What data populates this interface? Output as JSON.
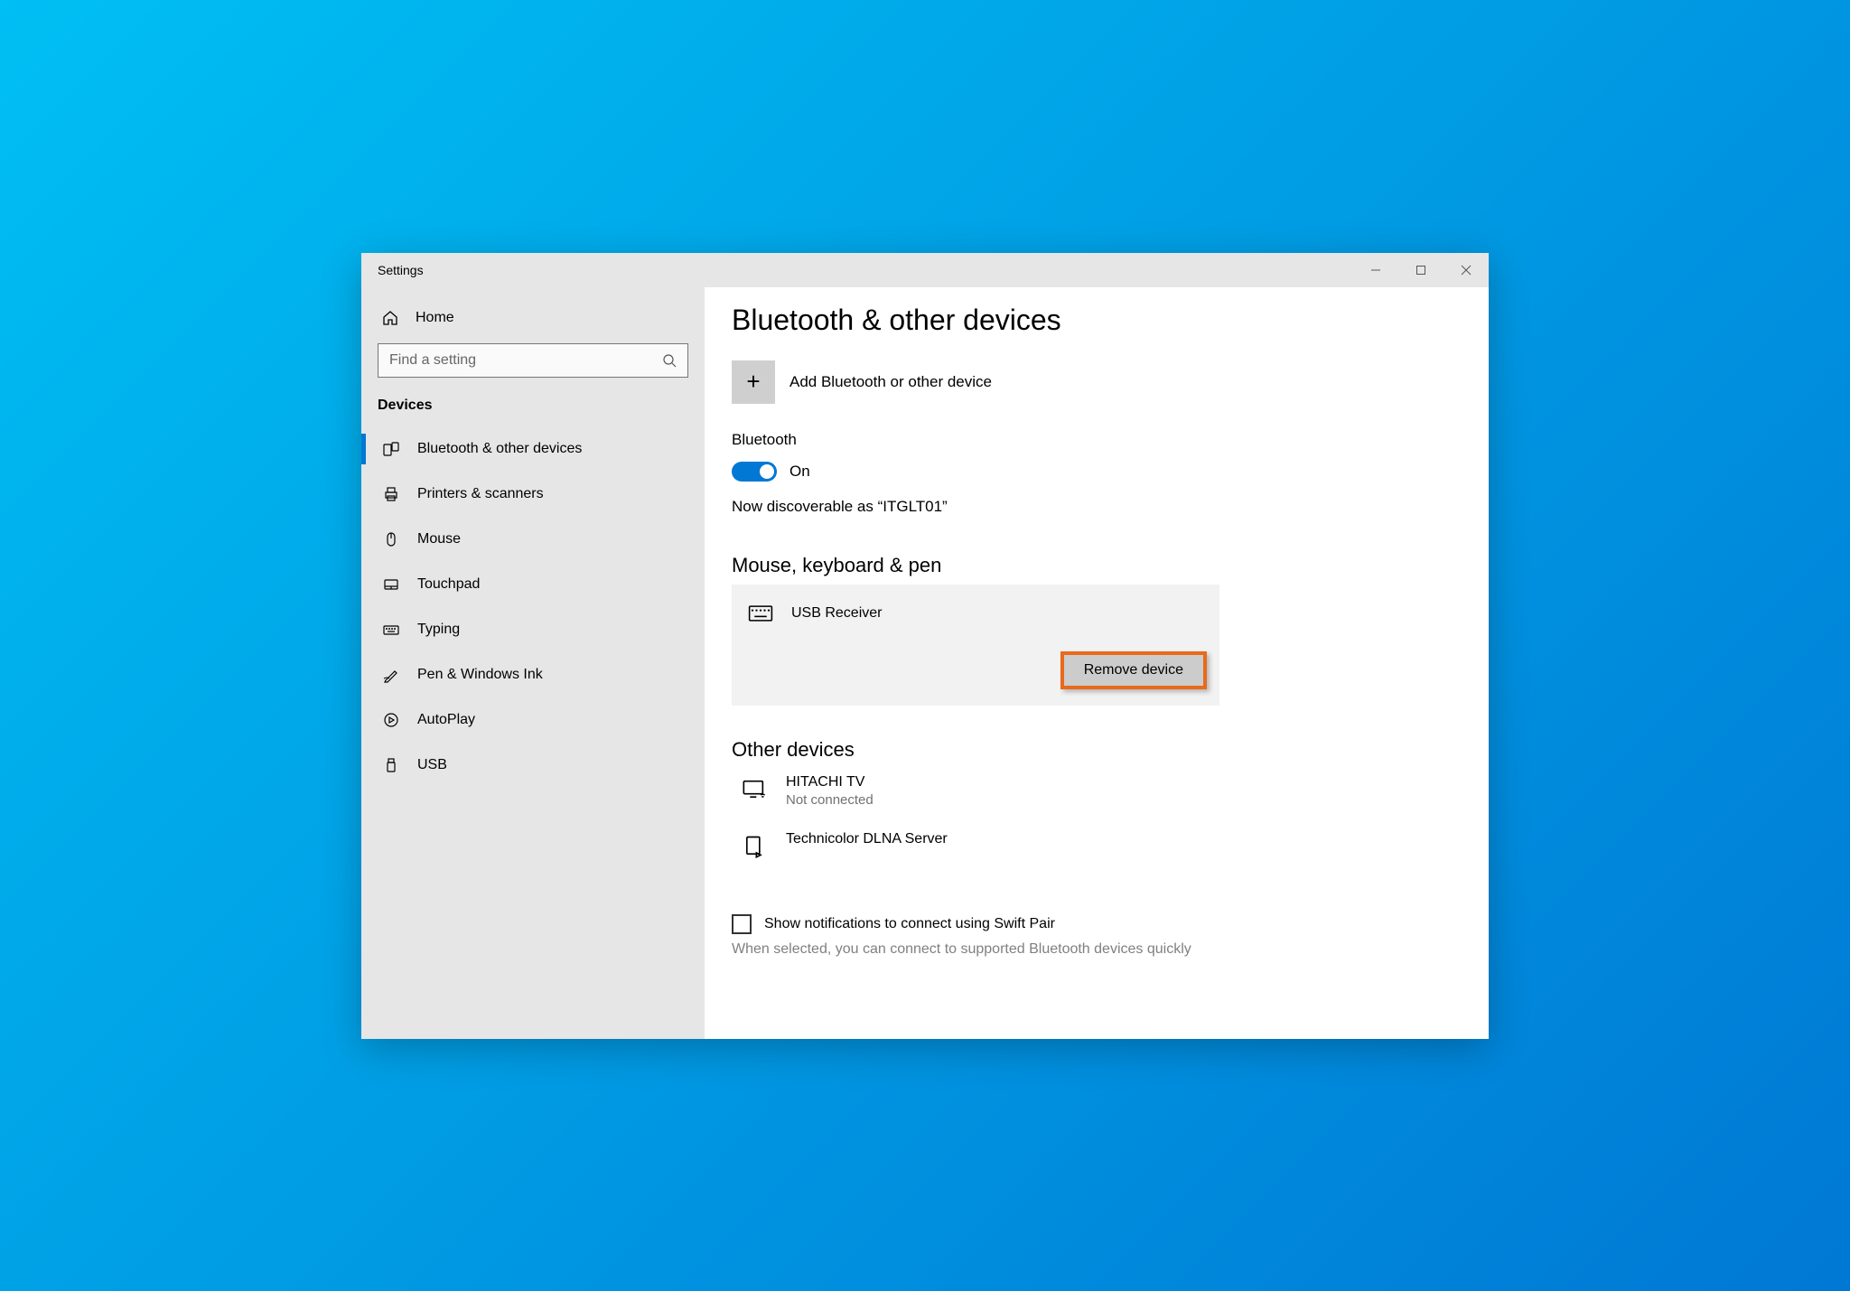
{
  "window": {
    "title": "Settings"
  },
  "sidebar": {
    "home": "Home",
    "search_placeholder": "Find a setting",
    "section": "Devices",
    "items": [
      {
        "label": "Bluetooth & other devices"
      },
      {
        "label": "Printers & scanners"
      },
      {
        "label": "Mouse"
      },
      {
        "label": "Touchpad"
      },
      {
        "label": "Typing"
      },
      {
        "label": "Pen & Windows Ink"
      },
      {
        "label": "AutoPlay"
      },
      {
        "label": "USB"
      }
    ]
  },
  "main": {
    "title": "Bluetooth & other devices",
    "add_label": "Add Bluetooth or other device",
    "bluetooth": {
      "heading": "Bluetooth",
      "state": "On",
      "discoverable": "Now discoverable as “ITGLT01”"
    },
    "group1": {
      "heading": "Mouse, keyboard & pen",
      "device": "USB Receiver",
      "remove": "Remove device"
    },
    "group2": {
      "heading": "Other devices",
      "d1": {
        "name": "HITACHI TV",
        "status": "Not connected"
      },
      "d2": {
        "name": "Technicolor DLNA Server"
      }
    },
    "swift": {
      "label": "Show notifications to connect using Swift Pair",
      "desc": "When selected, you can connect to supported Bluetooth devices quickly"
    }
  }
}
